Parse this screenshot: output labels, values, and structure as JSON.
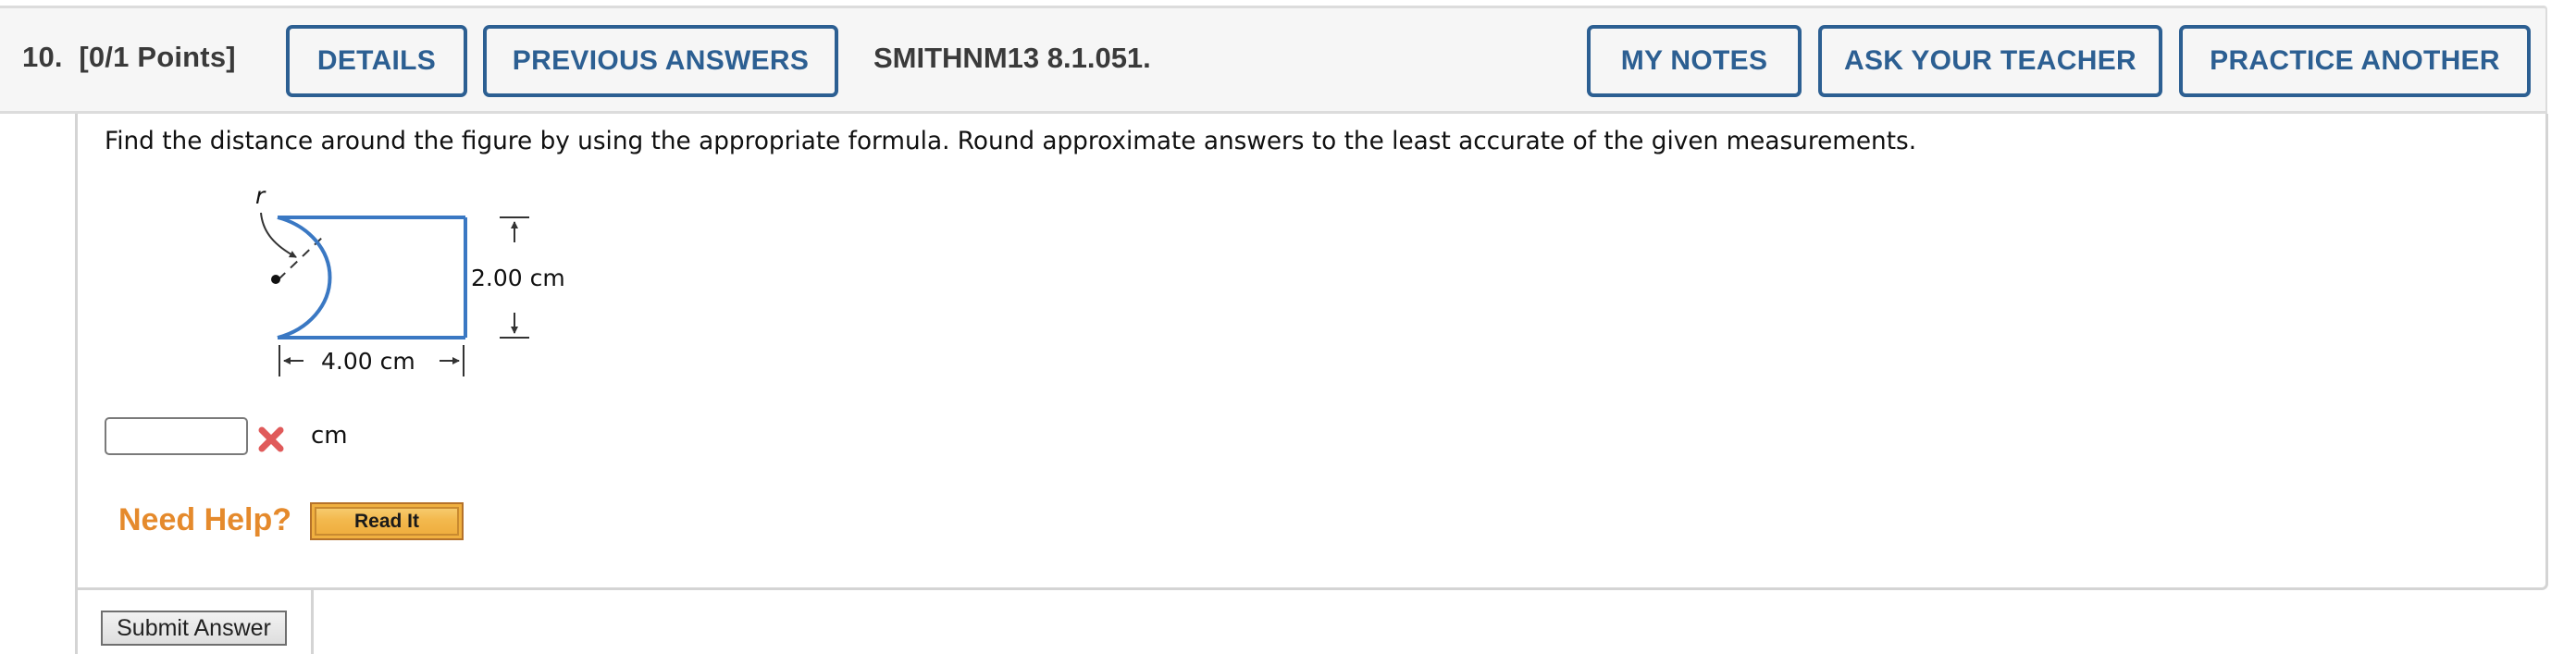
{
  "question": {
    "number_label": "10.  [0/1 Points]",
    "code": "SMITHNM13 8.1.051.",
    "buttons_left": [
      {
        "label": "DETAILS"
      },
      {
        "label": "PREVIOUS ANSWERS"
      }
    ],
    "buttons_right": [
      {
        "label": "MY NOTES"
      },
      {
        "label": "ASK YOUR TEACHER"
      },
      {
        "label": "PRACTICE ANOTHER"
      }
    ],
    "prompt": "Find the distance around the figure by using the appropriate formula. Round approximate answers to the least accurate of the given measurements."
  },
  "figure": {
    "radius_label": "r",
    "height_label": "2.00 cm",
    "width_label": "4.00 cm",
    "shape_color": "#3a78c3"
  },
  "answer": {
    "value": "",
    "placeholder": "",
    "status_icon": "wrong-x-icon",
    "status_color": "#e05a5a",
    "unit": "cm"
  },
  "help": {
    "label": "Need Help?",
    "read_it_label": "Read It",
    "label_color": "#e58a2c"
  },
  "submit": {
    "label": "Submit Answer"
  }
}
